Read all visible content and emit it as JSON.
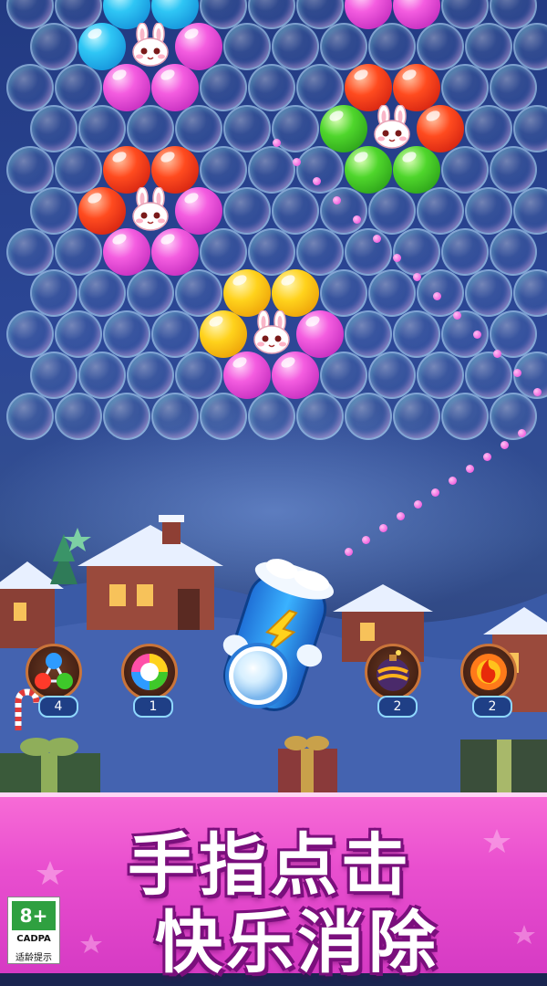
{
  "game": {
    "colors": {
      "cyan": "#2fc6f5",
      "magenta": "#f45de0",
      "red": "#ff4b1f",
      "green": "#4fd62c",
      "yellow": "#ffd21c"
    },
    "bubble_rows": [
      [
        "empty",
        "empty",
        "cyan",
        "cyan",
        "empty",
        "empty",
        "empty",
        "magenta",
        "magenta",
        "empty",
        "empty"
      ],
      [
        "empty",
        "cyan",
        "bunny",
        "magenta",
        "empty",
        "empty",
        "empty",
        "empty",
        "empty",
        "empty",
        "empty"
      ],
      [
        "empty",
        "empty",
        "magenta",
        "magenta",
        "empty",
        "empty",
        "empty",
        "red",
        "red",
        "empty",
        "empty"
      ],
      [
        "empty",
        "empty",
        "empty",
        "empty",
        "empty",
        "empty",
        "green",
        "bunny",
        "red",
        "empty",
        "empty"
      ],
      [
        "empty",
        "empty",
        "red",
        "red",
        "empty",
        "empty",
        "empty",
        "green",
        "green",
        "empty",
        "empty"
      ],
      [
        "empty",
        "red",
        "bunny",
        "magenta",
        "empty",
        "empty",
        "empty",
        "empty",
        "empty",
        "empty",
        "empty"
      ],
      [
        "empty",
        "empty",
        "magenta",
        "magenta",
        "empty",
        "empty",
        "empty",
        "empty",
        "empty",
        "empty",
        "empty"
      ],
      [
        "empty",
        "empty",
        "empty",
        "empty",
        "yellow",
        "yellow",
        "empty",
        "empty",
        "empty",
        "empty",
        "empty"
      ],
      [
        "empty",
        "empty",
        "empty",
        "empty",
        "yellow",
        "bunny",
        "magenta",
        "empty",
        "empty",
        "empty",
        "empty"
      ],
      [
        "empty",
        "empty",
        "empty",
        "empty",
        "magenta",
        "magenta",
        "empty",
        "empty",
        "empty",
        "empty",
        "empty"
      ],
      [
        "empty",
        "empty",
        "empty",
        "empty",
        "empty",
        "empty",
        "empty",
        "empty",
        "empty",
        "empty",
        "empty"
      ]
    ],
    "shooter": {
      "icon": "lightning-cannon-icon",
      "loaded_bubble": "empty"
    },
    "boosters": [
      {
        "icon": "three-color-balls-icon",
        "count": "4"
      },
      {
        "icon": "rainbow-ball-icon",
        "count": "1"
      },
      {
        "icon": "bomb-icon",
        "count": "2"
      },
      {
        "icon": "fireball-icon",
        "count": "2"
      }
    ]
  },
  "banner": {
    "line1": "手指点击",
    "line2": "快乐消除"
  },
  "age_rating": {
    "age": "8+",
    "org": "CADPA",
    "note": "适龄提示"
  }
}
